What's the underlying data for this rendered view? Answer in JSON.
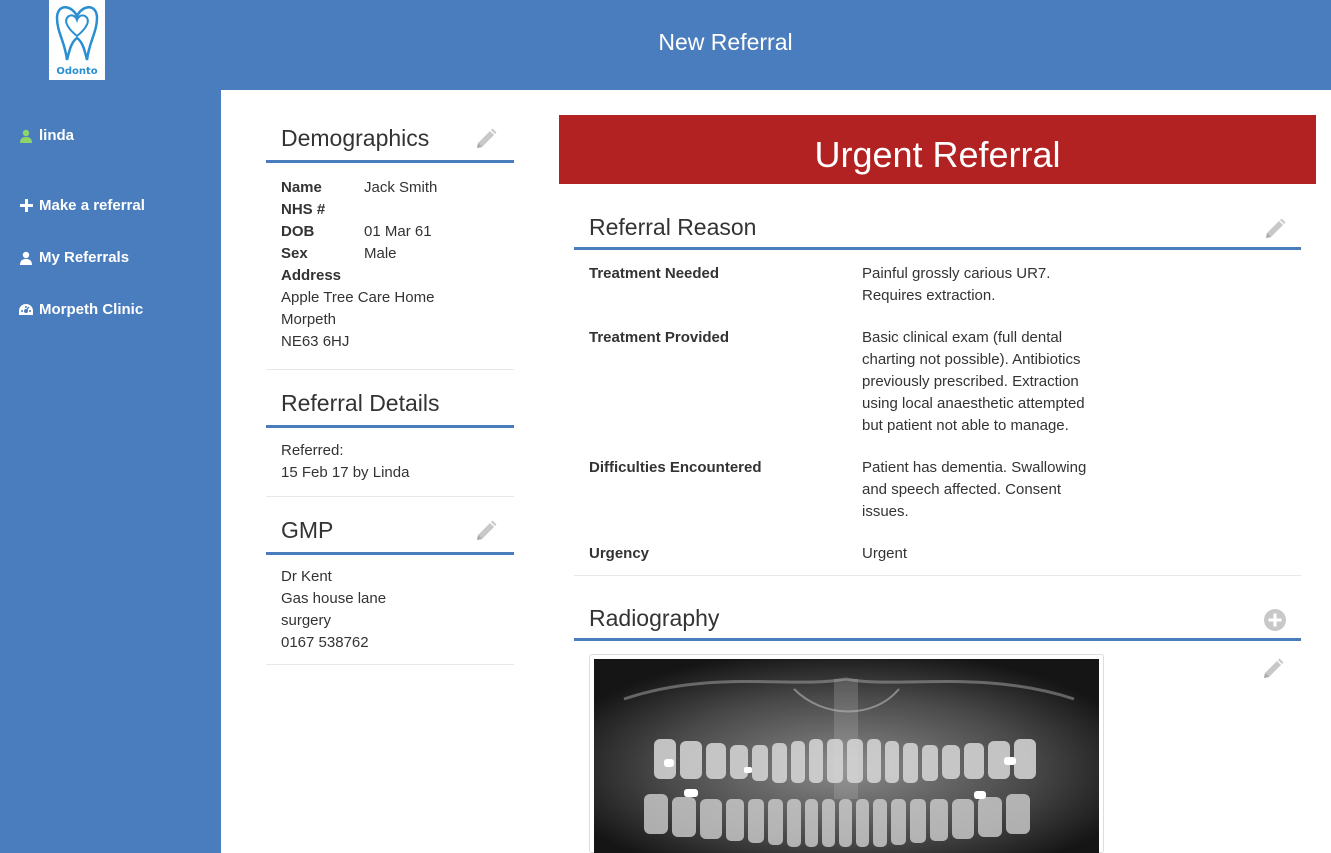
{
  "header": {
    "logo_text": "Odonto",
    "title": "New Referral"
  },
  "sidebar": {
    "user": "linda",
    "items": [
      {
        "label": "Make a referral",
        "icon": "plus-icon"
      },
      {
        "label": "My Referrals",
        "icon": "user-icon"
      },
      {
        "label": "Morpeth Clinic",
        "icon": "dashboard-icon"
      }
    ]
  },
  "demographics": {
    "title": "Demographics",
    "name_label": "Name",
    "name": "Jack Smith",
    "nhs_label": "NHS #",
    "nhs": "",
    "dob_label": "DOB",
    "dob": "01 Mar 61",
    "sex_label": "Sex",
    "sex": "Male",
    "address_label": "Address",
    "address_lines": [
      "Apple Tree Care Home",
      "Morpeth",
      "NE63 6HJ"
    ]
  },
  "referral_details": {
    "title": "Referral Details",
    "referred_label": "Referred:",
    "referred_value": "15 Feb 17 by Linda"
  },
  "gmp": {
    "title": "GMP",
    "lines": [
      "Dr Kent",
      "Gas house lane",
      "surgery",
      "0167 538762"
    ]
  },
  "banner": {
    "text": "Urgent Referral",
    "color": "#b22222"
  },
  "referral_reason": {
    "title": "Referral Reason",
    "rows": [
      {
        "label": "Treatment Needed",
        "lines": [
          "Painful grossly carious UR7.",
          "Requires extraction."
        ]
      },
      {
        "label": "Treatment Provided",
        "lines": [
          "Basic clinical exam (full dental",
          "charting not possible). Antibiotics",
          "previously prescribed. Extraction",
          "using local anaesthetic attempted",
          "but patient not able to manage."
        ]
      },
      {
        "label": "Difficulties Encountered",
        "lines": [
          "Patient has dementia. Swallowing",
          "and speech affected. Consent",
          "issues."
        ]
      },
      {
        "label": "Urgency",
        "lines": [
          "Urgent"
        ]
      }
    ]
  },
  "radiography": {
    "title": "Radiography"
  },
  "colors": {
    "brand_blue": "#4a7dbd",
    "user_green": "#8fd46a"
  }
}
